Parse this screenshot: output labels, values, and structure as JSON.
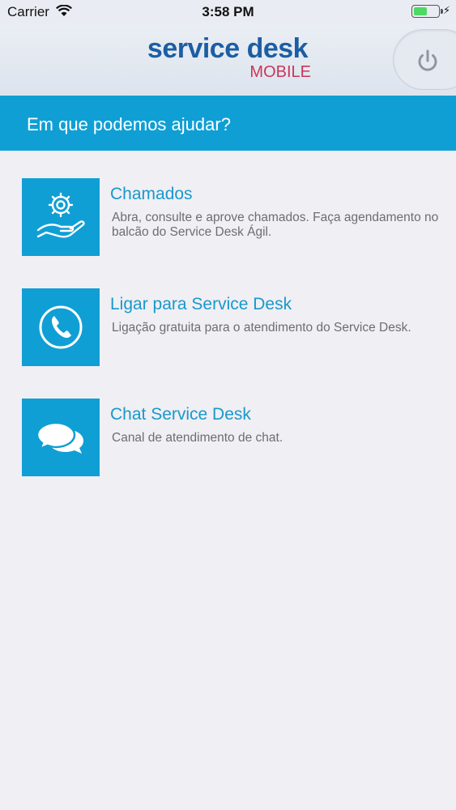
{
  "status_bar": {
    "carrier": "Carrier",
    "time": "3:58 PM",
    "icons": [
      "wifi-icon",
      "battery-icon",
      "charging-icon"
    ]
  },
  "header": {
    "logo_main": "service desk",
    "logo_sub": "MOBILE",
    "power_icon": "power-icon"
  },
  "banner": {
    "text": "Em que podemos ajudar?"
  },
  "menu": [
    {
      "icon": "gear-hand-icon",
      "title": "Chamados",
      "description": "Abra, consulte e aprove chamados. Faça agendamento no balcão do Service Desk Ágil."
    },
    {
      "icon": "phone-icon",
      "title": "Ligar para Service Desk",
      "description": "Ligação gratuita para o atendimento do Service Desk."
    },
    {
      "icon": "chat-bubbles-icon",
      "title": "Chat Service Desk",
      "description": "Canal de atendimento de chat."
    }
  ],
  "colors": {
    "accent": "#109fd4",
    "logo_blue": "#1c5ea3",
    "logo_red": "#c8375a",
    "background": "#efeff4"
  }
}
